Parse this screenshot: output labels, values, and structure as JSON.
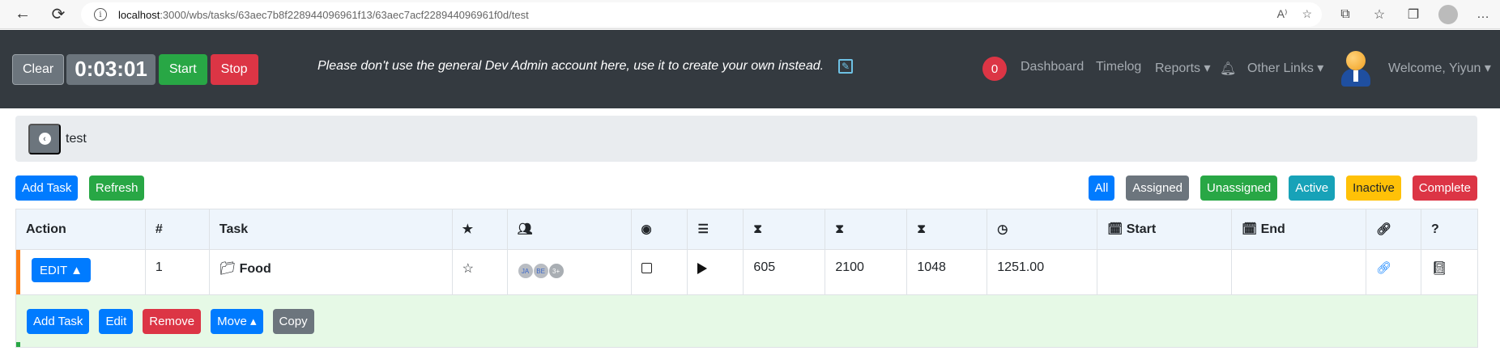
{
  "browser": {
    "url_host": "localhost",
    "url_path": ":3000/wbs/tasks/63aec7b8f228944096961f13/63aec7acf228944096961f0d/test"
  },
  "header": {
    "clear_label": "Clear",
    "timer": "0:03:01",
    "start_label": "Start",
    "stop_label": "Stop",
    "notice": "Please don't use the general Dev Admin account here, use it to create your own instead.",
    "notification_count": "0",
    "nav": {
      "dashboard": "Dashboard",
      "timelog": "Timelog",
      "reports": "Reports ▾",
      "other_links": "Other Links ▾",
      "welcome": "Welcome, Yiyun ▾"
    }
  },
  "breadcrumb": {
    "title": "test"
  },
  "toolbar": {
    "add_task": "Add Task",
    "refresh": "Refresh",
    "filters": {
      "all": "All",
      "assigned": "Assigned",
      "unassigned": "Unassigned",
      "active": "Active",
      "inactive": "Inactive",
      "complete": "Complete"
    }
  },
  "table": {
    "headers": {
      "action": "Action",
      "number": "#",
      "task": "Task",
      "start": "Start",
      "end": "End",
      "help": "?"
    },
    "row": {
      "edit_label": "EDIT ▲",
      "number": "1",
      "task_name": "Food",
      "members": [
        "JA",
        "BE",
        "3+"
      ],
      "hours_best": "605",
      "hours_worst": "2100",
      "hours_most": "1048",
      "estimated_hours": "1251.00",
      "start": "",
      "end": ""
    }
  },
  "row_actions": {
    "add_task": "Add Task",
    "edit": "Edit",
    "remove": "Remove",
    "move": "Move ▴",
    "copy": "Copy"
  }
}
